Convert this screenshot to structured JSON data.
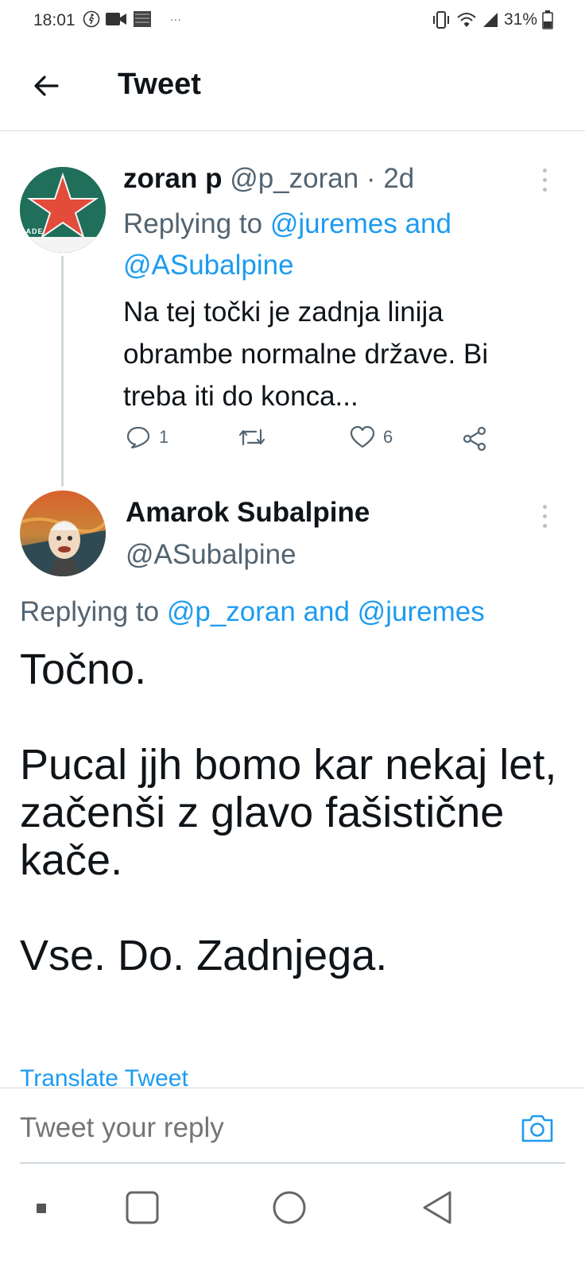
{
  "status_bar": {
    "time": "18:01",
    "battery": "31%",
    "more_glyph": "···"
  },
  "header": {
    "title": "Tweet"
  },
  "tweets": [
    {
      "display_name": "zoran p",
      "handle": "@p_zoran",
      "separator": " · ",
      "age": "2d",
      "replying_prefix": "Replying to ",
      "replying_targets": "@juremes and @ASubalpine",
      "text": "Na tej točki je zadnja linija obrambe normalne države. Bi treba iti do konca...",
      "avatar_text": "RADE",
      "reply_count": "1",
      "retweet_count": "",
      "like_count": "6"
    },
    {
      "display_name": "Amarok Subalpine",
      "handle": "@ASubalpine",
      "replying_prefix": "Replying to ",
      "replying_targets": "@p_zoran and @juremes",
      "text": "Točno.\n\nPucal jjh bomo kar nekaj let, začenši z glavo fašistične kače.\n\nVse. Do. Zadnjega.",
      "translate_label": "Translate Tweet"
    }
  ],
  "reply_bar": {
    "placeholder": "Tweet your reply"
  },
  "icons": {
    "back": "arrow-left-icon",
    "more": "more-vertical-icon",
    "reply": "comment-icon",
    "retweet": "retweet-icon",
    "like": "heart-icon",
    "share": "share-icon",
    "camera": "camera-icon"
  },
  "colors": {
    "accent": "#1d9bf0",
    "text": "#0f1419",
    "secondary": "#536471"
  }
}
